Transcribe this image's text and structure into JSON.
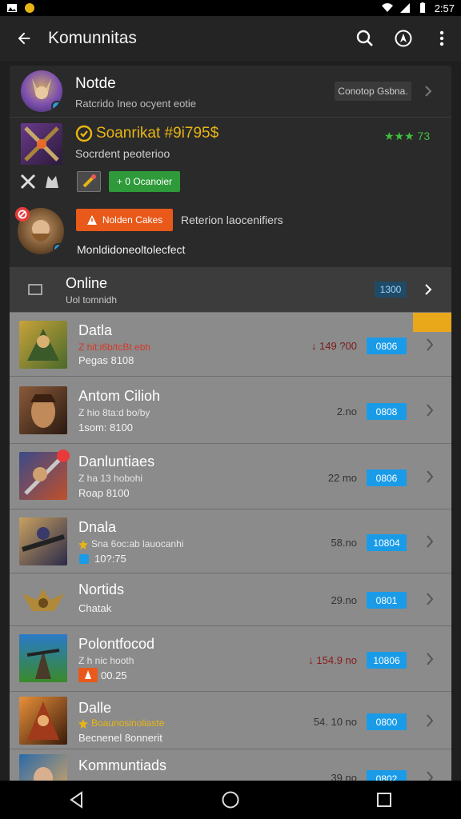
{
  "status": {
    "time": "2:57"
  },
  "appbar": {
    "title": "Komunnitas",
    "icons": [
      "back-arrow-icon",
      "search-icon",
      "compass-icon",
      "more-vert-icon"
    ]
  },
  "profile": {
    "name": "Notde",
    "subtitle": "Ratcrido Ineo ocyent eotie",
    "side_button": "Conotop Gsbna.",
    "game_title": "Soanrikat #9i795$",
    "game_sub": "Socrdent peoterioo",
    "rating": "★★★ 73",
    "green_button": "+ 0 Ocanoier",
    "orange_button": "Nolden Cakes",
    "orange_label": "Reterion laocenifiers",
    "footer_note": "Monldidoneoltolecfect"
  },
  "online": {
    "title": "Online",
    "subtitle": "Uol tomnidh",
    "count": "1300"
  },
  "rows": [
    {
      "name": "Datla",
      "sub1": "Z hit:i6b/tcBt ebh",
      "sub2": "Pegas 8108",
      "value": "↓ 149 ?00",
      "pill": "0806"
    },
    {
      "name": "Antom Cilioh",
      "sub1": "Z hio  8ta:d bo/by",
      "sub2": "1som: 8100",
      "value": "2.no",
      "pill": "0808"
    },
    {
      "name": "Danluntiaes",
      "sub1": "Z  ha 13  hobohi",
      "sub2": "Roap 8100",
      "value": "22 mo",
      "pill": "0806"
    },
    {
      "name": "Dnala",
      "sub1": "Sna 6oc:ab lauocanhi",
      "sub2": "10?:75",
      "value": "58.no",
      "pill": "10804"
    },
    {
      "name": "Nortids",
      "sub1": "",
      "sub2": "Chatak",
      "value": "29.no",
      "pill": "0801"
    },
    {
      "name": "Polontfocod",
      "sub1": "Z  h  nic hooth",
      "sub2": "00.25",
      "value": "↓ 154.9 no",
      "pill": "10806"
    },
    {
      "name": "Dalle",
      "sub1": "Boaunosinoliaste",
      "sub2": "Becnenel 8onnerit",
      "value": "54. 10 no",
      "pill": "0800"
    },
    {
      "name": "Kommuntiads",
      "sub1": "",
      "sub2": "",
      "value": "39 no",
      "pill": "0802"
    }
  ],
  "colors": {
    "accent_blue": "#1a9be8",
    "accent_orange": "#e8591a",
    "accent_green": "#2e9a3a",
    "gold": "#e8b514"
  }
}
